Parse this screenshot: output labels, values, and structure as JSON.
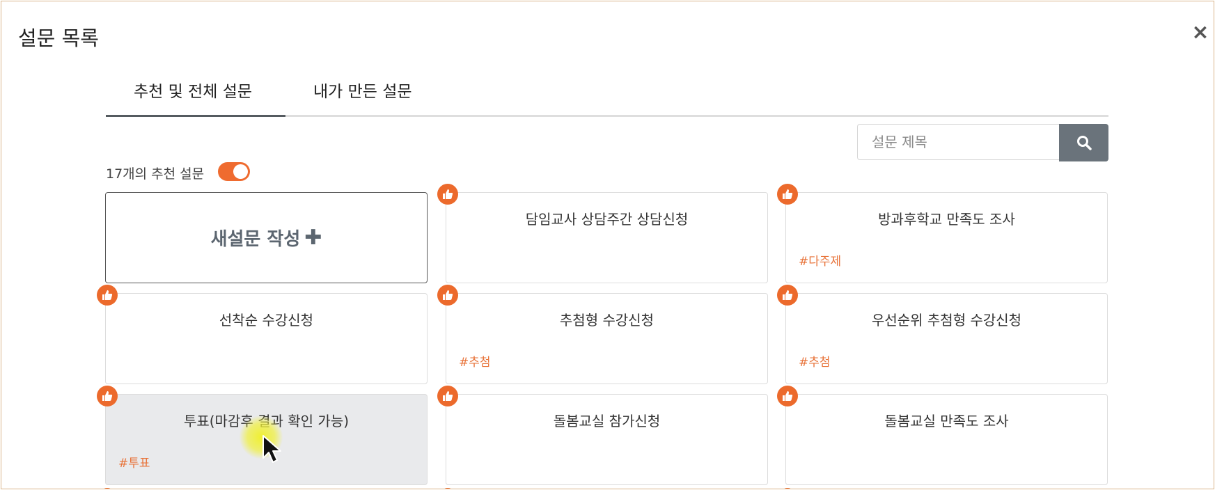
{
  "dialog": {
    "title": "설문 목록",
    "close_label": "×"
  },
  "tabs": [
    {
      "label": "추천 및 전체 설문",
      "active": true
    },
    {
      "label": "내가 만든 설문",
      "active": false
    }
  ],
  "search": {
    "placeholder": "설문 제목",
    "value": ""
  },
  "recommended": {
    "label": "17개의 추천 설문",
    "toggle_on": true
  },
  "new_survey": {
    "label": "새설문 작성",
    "plus": "✚"
  },
  "cards": [
    {
      "title": "담임교사 상담주간 상담신청",
      "tag": ""
    },
    {
      "title": "방과후학교 만족도 조사",
      "tag": "#다주제"
    },
    {
      "title": "선착순 수강신청",
      "tag": ""
    },
    {
      "title": "추첨형 수강신청",
      "tag": "#추첨"
    },
    {
      "title": "우선순위 추첨형 수강신청",
      "tag": "#추첨"
    },
    {
      "title": "투표(마감후 결과 확인 가능)",
      "tag": "#투표"
    },
    {
      "title": "돌봄교실 참가신청",
      "tag": ""
    },
    {
      "title": "돌봄교실 만족도 조사",
      "tag": ""
    }
  ],
  "colors": {
    "accent": "#ec6a2c",
    "tag": "#e8743b",
    "search_button": "#6a737b",
    "hover_card": "#e9eaec",
    "border": "#d9b48a"
  },
  "icons": {
    "badge": "thumbs-up-icon",
    "search": "search-icon",
    "close": "close-icon",
    "add": "plus-icon"
  }
}
